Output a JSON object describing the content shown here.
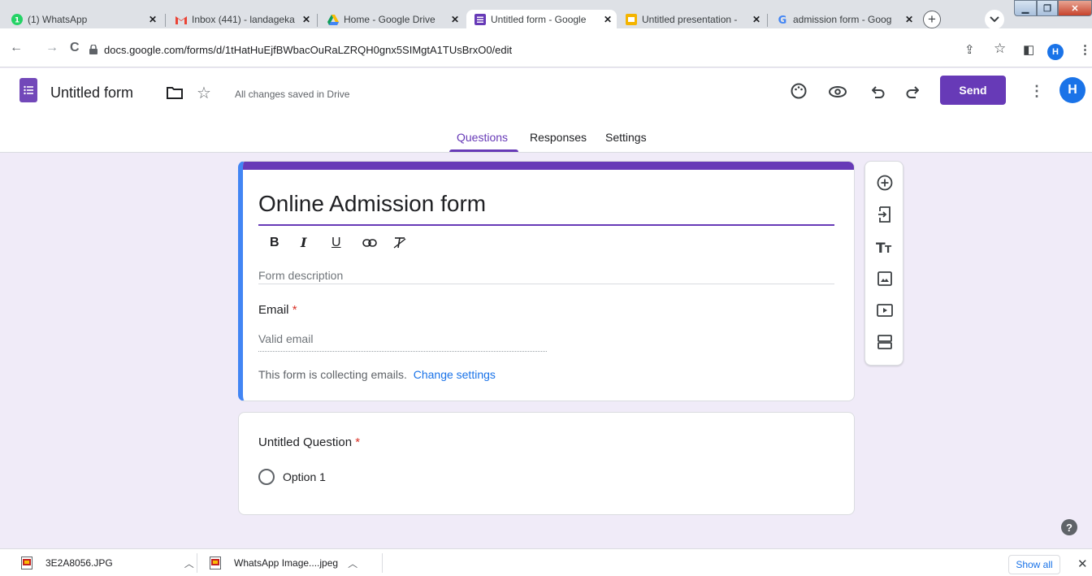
{
  "browser": {
    "tabs": [
      {
        "title": "(1) WhatsApp",
        "icon": "whatsapp-icon",
        "color": "#25d366"
      },
      {
        "title": "Inbox (441) - landageka",
        "icon": "gmail-icon",
        "color": "#ea4335"
      },
      {
        "title": "Home - Google Drive",
        "icon": "drive-icon",
        "color": "#fbbc04"
      },
      {
        "title": "Untitled form - Google",
        "icon": "forms-icon",
        "color": "#673ab7"
      },
      {
        "title": "Untitled presentation -",
        "icon": "slides-icon",
        "color": "#f4b400"
      },
      {
        "title": "admission form - Goog",
        "icon": "google-icon",
        "color": "#4285f4"
      }
    ],
    "url": "docs.google.com/forms/d/1tHatHuEjfBWbacOuRaLZRQH0gnx5SIMgtA1TUsBrxO0/edit",
    "profile_initial": "H"
  },
  "header": {
    "form_title": "Untitled form",
    "save_status": "All changes saved in Drive",
    "send_label": "Send",
    "avatar_initial": "H",
    "tabs": [
      "Questions",
      "Responses",
      "Settings"
    ],
    "active_tab": "Questions"
  },
  "form": {
    "heading": "Online Admission form",
    "description_placeholder": "Form description",
    "email_label": "Email",
    "required_marker": "*",
    "email_placeholder": "Valid email",
    "collecting_text": "This form is collecting emails.",
    "change_settings_label": "Change settings"
  },
  "question": {
    "title": "Untitled Question",
    "required_marker": "*",
    "option_label": "Option 1"
  },
  "side_toolbar": [
    "add-question-icon",
    "import-questions-icon",
    "add-title-icon",
    "add-image-icon",
    "add-video-icon",
    "add-section-icon"
  ],
  "downloads": {
    "items": [
      {
        "name": "3E2A8056.JPG"
      },
      {
        "name": "WhatsApp Image....jpeg"
      }
    ],
    "show_all_label": "Show all"
  },
  "colors": {
    "accent": "#673ab7",
    "background": "#f0ebf8",
    "link": "#1a73e8"
  }
}
